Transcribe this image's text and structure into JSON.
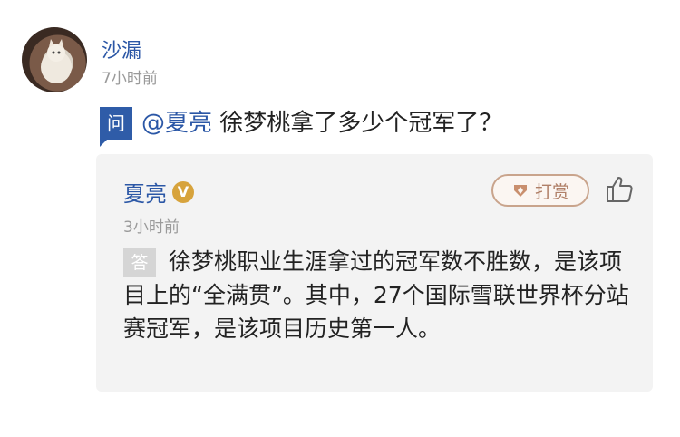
{
  "post": {
    "user_name": "沙漏",
    "time": "7小时前",
    "ask_badge": "问",
    "mention": "@夏亮",
    "question": " 徐梦桃拿了多少个冠军了？"
  },
  "answer": {
    "answerer_name": "夏亮",
    "verified_badge": "V",
    "tip_label": "打赏",
    "time": "3小时前",
    "answer_badge": "答",
    "text": "徐梦桃职业生涯拿过的冠军数不胜数，是该项目上的“全满贯”。其中，27个国际雪联世界杯分站赛冠军，是该项目历史第一人。"
  },
  "colors": {
    "link_blue": "#2b57a6",
    "ask_badge_bg": "#2f5ca8",
    "card_bg": "#f3f3f3",
    "tip_border": "#c9a48c",
    "verified_gold": "#d7a33c"
  },
  "icons": {
    "avatar": "cat-photo-avatar",
    "tip": "coin-tip-icon",
    "like": "thumbs-up-icon"
  }
}
